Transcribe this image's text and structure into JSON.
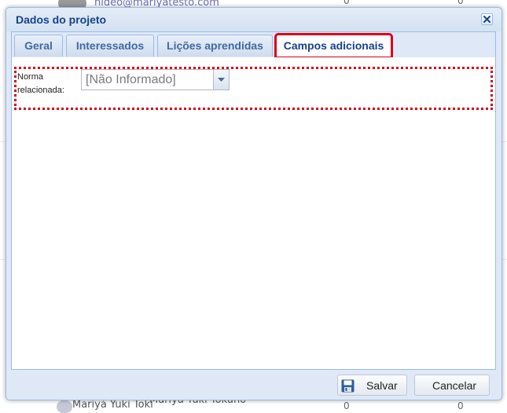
{
  "background": {
    "top_row": {
      "email": "hideo@mariyatesto.com",
      "count_a": "0",
      "count_b": "0"
    },
    "bottom_row": {
      "name_a": "Mariyá Yuki Toki",
      "name_b": "Mariya Yuki Tokuno",
      "count_a": "0",
      "count_b": "0"
    }
  },
  "window": {
    "title": "Dados do projeto",
    "close_icon": "close-icon"
  },
  "tabs": [
    {
      "label": "Geral",
      "active": false
    },
    {
      "label": "Interessados",
      "active": false
    },
    {
      "label": "Lições aprendidas",
      "active": false
    },
    {
      "label": "Campos adicionais",
      "active": true
    }
  ],
  "form": {
    "norma_label_line1": "Norma",
    "norma_label_line2": "relacionada:",
    "norma_value": "[Não Informado]"
  },
  "footer": {
    "save_label": "Salvar",
    "cancel_label": "Cancelar",
    "save_icon": "floppy-disk-icon"
  },
  "colors": {
    "window_bg": "#dfe8f6",
    "border": "#99bbe8",
    "title": "#15428b",
    "highlight": "#d9001b"
  }
}
